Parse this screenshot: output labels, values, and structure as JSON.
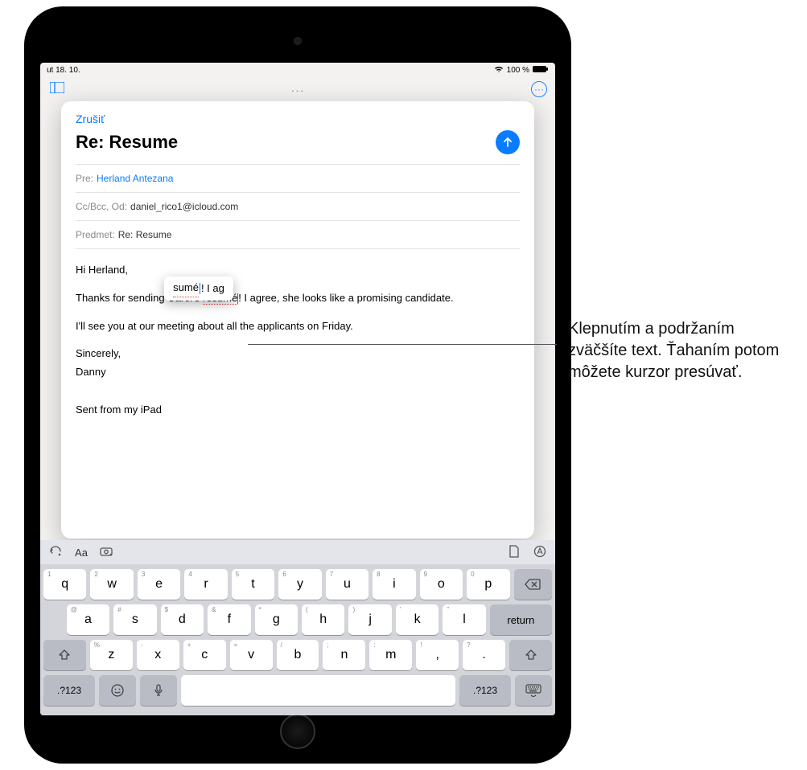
{
  "status_bar": {
    "time": "ut 18. 10.",
    "battery_text": "100 %"
  },
  "bg_toolbar": {
    "sidebar_icon": "▢",
    "more_icon": "···"
  },
  "compose": {
    "cancel": "Zrušiť",
    "subject_title": "Re: Resume",
    "to_label": "Pre:",
    "to_value": "Herland Antezana",
    "cc_label": "Cc/Bcc, Od:",
    "cc_value": "daniel_rico1@icloud.com",
    "subject_label": "Predmet:",
    "subject_value": "Re: Resume"
  },
  "body": {
    "greeting": "Hi Herland,",
    "line1_a": "Thanks for sending Carol's ",
    "line1_word": "résumé",
    "line1_b": "! I agree, she looks like a promising candidate.",
    "line2": "I'll see you at our meeting about all the applicants on Friday.",
    "signoff1": "Sincerely,",
    "signoff2": "Danny",
    "footer": "Sent from my iPad"
  },
  "magnifier": {
    "left": "sumé",
    "right": "! I ag"
  },
  "keyboard": {
    "row1": [
      {
        "alt": "1",
        "k": "q"
      },
      {
        "alt": "2",
        "k": "w"
      },
      {
        "alt": "3",
        "k": "e"
      },
      {
        "alt": "4",
        "k": "r"
      },
      {
        "alt": "5",
        "k": "t"
      },
      {
        "alt": "6",
        "k": "y"
      },
      {
        "alt": "7",
        "k": "u"
      },
      {
        "alt": "8",
        "k": "i"
      },
      {
        "alt": "9",
        "k": "o"
      },
      {
        "alt": "0",
        "k": "p"
      }
    ],
    "row2": [
      {
        "alt": "@",
        "k": "a"
      },
      {
        "alt": "#",
        "k": "s"
      },
      {
        "alt": "$",
        "k": "d"
      },
      {
        "alt": "&",
        "k": "f"
      },
      {
        "alt": "*",
        "k": "g"
      },
      {
        "alt": "(",
        "k": "h"
      },
      {
        "alt": ")",
        "k": "j"
      },
      {
        "alt": "'",
        "k": "k"
      },
      {
        "alt": "\"",
        "k": "l"
      }
    ],
    "row3": [
      {
        "alt": "%",
        "k": "z"
      },
      {
        "alt": "-",
        "k": "x"
      },
      {
        "alt": "+",
        "k": "c"
      },
      {
        "alt": "=",
        "k": "v"
      },
      {
        "alt": "/",
        "k": "b"
      },
      {
        "alt": ";",
        "k": "n"
      },
      {
        "alt": ":",
        "k": "m"
      },
      {
        "alt": "!",
        "k": ","
      },
      {
        "alt": "?",
        "k": "."
      }
    ],
    "return_label": "return",
    "num_label": ".?123",
    "aa_label": "Aa"
  },
  "callout": {
    "text": "Klepnutím a podržaním zväčšíte text. Ťahaním potom môžete kurzor presúvať."
  }
}
